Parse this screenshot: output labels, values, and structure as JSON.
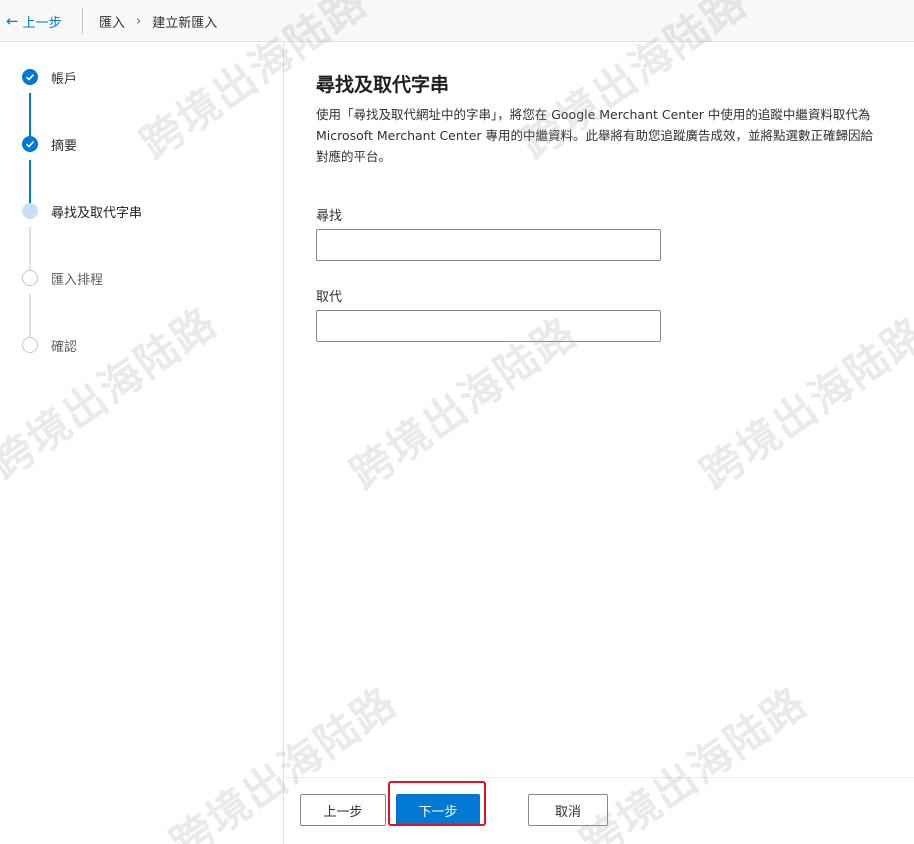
{
  "topbar": {
    "back_label": "上一步",
    "breadcrumb_root": "匯入",
    "breadcrumb_current": "建立新匯入"
  },
  "steps": [
    {
      "label": "帳戶",
      "status": "done"
    },
    {
      "label": "摘要",
      "status": "done"
    },
    {
      "label": "尋找及取代字串",
      "status": "current"
    },
    {
      "label": "匯入排程",
      "status": "pending"
    },
    {
      "label": "確認",
      "status": "pending"
    }
  ],
  "main": {
    "heading": "尋找及取代字串",
    "description": "使用「尋找及取代網址中的字串」，將您在 Google Merchant Center 中使用的追蹤中繼資料取代為 Microsoft Merchant Center 專用的中繼資料。此舉將有助您追蹤廣告成效，並將點選數正確歸因給對應的平台。",
    "find_label": "尋找",
    "find_value": "",
    "replace_label": "取代",
    "replace_value": ""
  },
  "footer": {
    "back_button": "上一步",
    "next_button": "下一步",
    "cancel_button": "取消"
  },
  "watermark": "跨境出海陆路",
  "colors": {
    "accent": "#0078d4",
    "current_step": "#c7e0f4",
    "highlight": "#e81123"
  }
}
